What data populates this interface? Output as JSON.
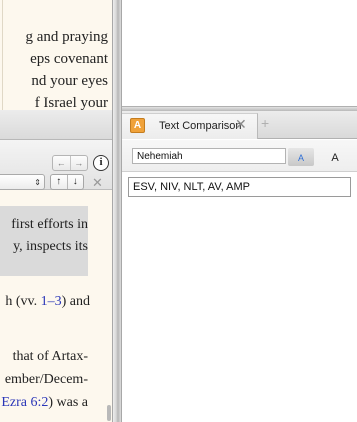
{
  "bible_text": {
    "lines": [
      "g and praying",
      "eps covenant",
      "nd your eyes",
      "f Israel your"
    ]
  },
  "commentary": {
    "nav_back": "←",
    "nav_forward": "→",
    "info_label": "i",
    "select_arrow": "⇕",
    "up_arrow": "↑",
    "down_arrow": "↓",
    "close_label": "✕",
    "highlight_lines": [
      "first efforts in",
      "y, inspects its"
    ],
    "line_1_prefix": "h (vv. ",
    "line_1_link": "1–3",
    "line_1_suffix": ") and",
    "line_2": "that of Artax-",
    "line_3": "ember/Decem-",
    "line_4_link": "Ezra 6:2",
    "line_4_suffix": ") was a"
  },
  "text_comparison": {
    "tab_badge": "A",
    "tab_title": "Text Comparison",
    "tab_close": "✕",
    "tab_add": "+",
    "book_value": "Nehemiah",
    "font_small": "A",
    "font_large": "A",
    "versions_value": "ESV, NIV, NLT, AV, AMP"
  },
  "colors": {
    "paper": "#fdf8ee",
    "link": "#2a36b8",
    "badge": "#f0a23a",
    "font_active": "#2f6fd6"
  }
}
